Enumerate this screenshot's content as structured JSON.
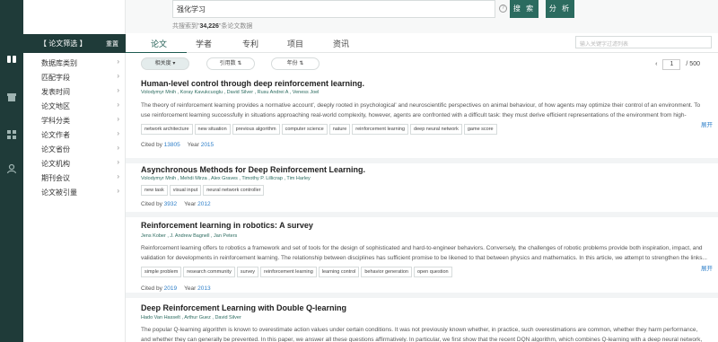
{
  "search": {
    "query": "强化学习",
    "button_search": "搜 索",
    "button_analyze": "分 析",
    "found_prefix": "共搜索到\"",
    "found_count": "34,226",
    "found_suffix": "\"条论文数据",
    "info_icon": "info-icon"
  },
  "sidebar": {
    "title": "【 论文筛选 】",
    "reset": "重置",
    "items": [
      {
        "label": "数据库类别"
      },
      {
        "label": "匹配字段"
      },
      {
        "label": "发表时间"
      },
      {
        "label": "论文地区"
      },
      {
        "label": "学科分类"
      },
      {
        "label": "论文作者"
      },
      {
        "label": "论文省份"
      },
      {
        "label": "论文机构"
      },
      {
        "label": "期刊会议"
      },
      {
        "label": "论文被引量"
      }
    ]
  },
  "tabs": {
    "items": [
      {
        "label": "论文"
      },
      {
        "label": "学者"
      },
      {
        "label": "专利"
      },
      {
        "label": "项目"
      },
      {
        "label": "资讯"
      }
    ],
    "filter_placeholder": "输入关键字过滤列表"
  },
  "sort": {
    "relevance": "相关度",
    "citations": "引用数",
    "year": "年份"
  },
  "pager": {
    "current": "1",
    "total": "/  500"
  },
  "labels": {
    "cited_by": "Cited by",
    "year": "Year",
    "expand": "展开"
  },
  "papers": [
    {
      "title": "Human-level control through deep reinforcement learning.",
      "authors": "Volodymyr Mnih , Koray Kavukcuoglu , David Silver , Rusu Andrei A , Veness Joel",
      "abstract": "The theory of reinforcement learning provides a normative account', deeply rooted in psychological' and neuroscientific perspectives on animal behaviour, of how agents may optimize their control of an environment. To use reinforcement learning successfully in situations approaching real-world complexity, however, agents are confronted with a difficult task: they must derive efficient representations of the environment from high-dimensional...",
      "tags": [
        "network architecture",
        "new situation",
        "previous algorithm",
        "computer science",
        "nature",
        "reinforcement learning",
        "deep neural network",
        "game score"
      ],
      "cited": "13805",
      "year": "2015"
    },
    {
      "title": "Asynchronous Methods for Deep Reinforcement Learning.",
      "authors": "Volodymyr Mnih , Mehdi Mirza , Alex Graves , Timothy P. Lillicrap , Tim Harley",
      "abstract": "",
      "tags": [
        "new task",
        "visual input",
        "neural network controller"
      ],
      "cited": "3932",
      "year": "2012"
    },
    {
      "title": "Reinforcement learning in robotics: A survey",
      "authors": "Jens Kober , J. Andrew Bagnell , Jan Peters",
      "abstract": "Reinforcement learning offers to robotics a framework and set of tools for the design of sophisticated and hard-to-engineer behaviors. Conversely, the challenges of robotic problems provide both inspiration, impact, and validation for developments in reinforcement learning. The relationship between disciplines has sufficient promise to be likened to that between physics and mathematics. In this article, we attempt to strengthen the links...",
      "tags": [
        "simple problem",
        "research community",
        "survey",
        "reinforcement learning",
        "learning control",
        "behavior generation",
        "open question"
      ],
      "cited": "2019",
      "year": "2013"
    },
    {
      "title": "Deep Reinforcement Learning with Double Q-learning",
      "authors": "Hado Van Hasselt , Arthur Guez , David Silver",
      "abstract": "The popular Q-learning algorithm is known to overestimate action values under certain conditions. It was not previously known whether, in practice, such overestimations are common, whether they harm performance, and whether they can generally be prevented. In this paper, we answer all these questions affirmatively. In particular, we first show that the recent DQN algorithm, which combines Q-learning with a deep neural network, suffers...",
      "tags": [],
      "cited": "",
      "year": ""
    }
  ]
}
